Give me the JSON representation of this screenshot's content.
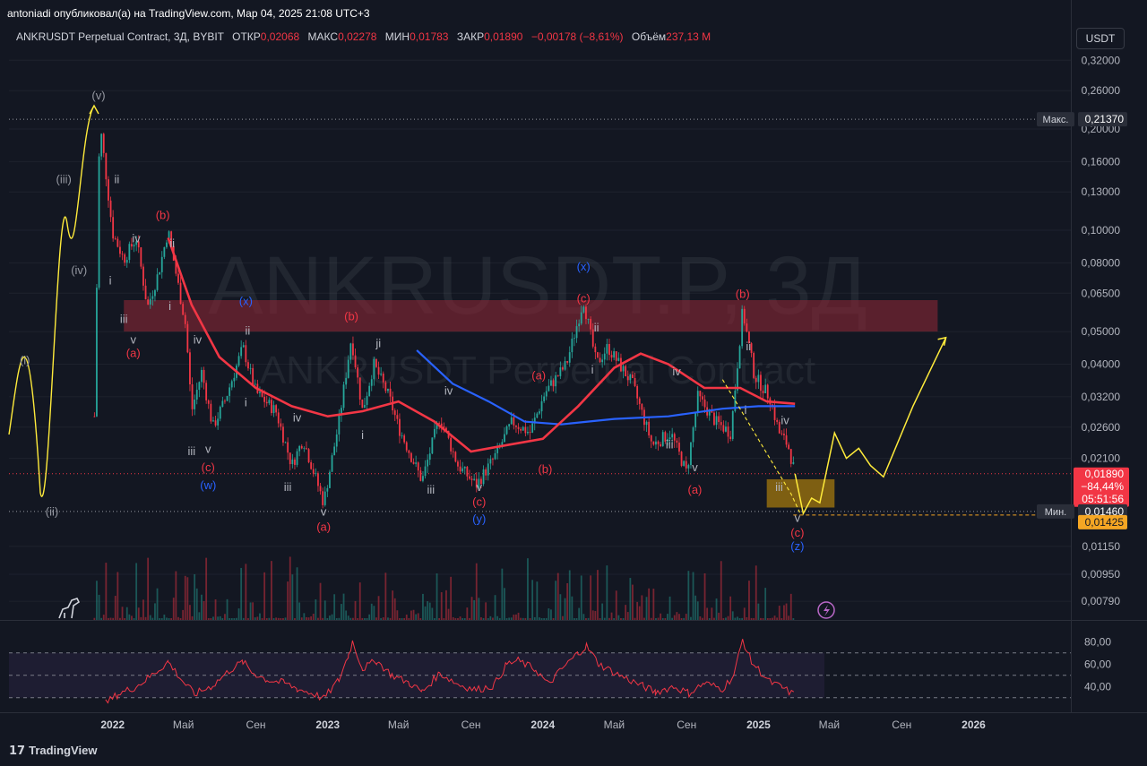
{
  "header": {
    "published": "antoniadi опубликовал(а) на TradingView.com, Мар 04, 2025 21:08 UTC+3",
    "symbol": "ANKRUSDT Perpetual Contract, 3Д, BYBIT",
    "open_label": "ОТКР",
    "open": "0,02068",
    "high_label": "МАКС",
    "high": "0,02278",
    "low_label": "МИН",
    "low": "0,01783",
    "close_label": "ЗАКР",
    "close": "0,01890",
    "change": "−0,00178 (−8,61%)",
    "volume_label": "Объём",
    "volume": "237,13 M",
    "currency": "USDT"
  },
  "watermark": {
    "main": "ANKRUSDT.P, 3Д",
    "sub": "ANKRUSDT Perpetual Contract"
  },
  "footer": {
    "brand": "TradingView"
  },
  "colors": {
    "bg": "#131722",
    "up": "#26a69a",
    "down": "#f23645",
    "ma_red": "#f23645",
    "ma_blue": "#2962ff",
    "wave_yellow": "#ffeb3b",
    "zone_red": "#8b2635",
    "zone_orange": "#b8860b",
    "rsi": "#f23645"
  },
  "chart_data": [
    {
      "type": "candlestick",
      "title": "ANKRUSDT Perpetual Contract, 3Д, BYBIT",
      "y_scale": "log",
      "y_ticks": [
        "0,32000",
        "0,26000",
        "0,20000",
        "0,16000",
        "0,13000",
        "0,10000",
        "0,08000",
        "0,06500",
        "0,05000",
        "0,04000",
        "0,03200",
        "0,02600",
        "0,02100",
        "0,01150",
        "0,00950",
        "0,00790"
      ],
      "x_ticks": [
        "2022",
        "Май",
        "Сен",
        "2023",
        "Май",
        "Сен",
        "2024",
        "Май",
        "Сен",
        "2025",
        "Май",
        "Сен",
        "2026"
      ],
      "x_ticks_bold": [
        "2022",
        "2023",
        "2024",
        "2025",
        "2026"
      ],
      "price_path": [
        [
          "2021-12-01",
          0.028
        ],
        [
          "2021-12-10",
          0.21
        ],
        [
          "2021-12-20",
          0.15
        ],
        [
          "2022-01-01",
          0.098
        ],
        [
          "2022-01-20",
          0.082
        ],
        [
          "2022-02-10",
          0.095
        ],
        [
          "2022-03-01",
          0.059
        ],
        [
          "2022-03-20",
          0.075
        ],
        [
          "2022-04-05",
          0.1
        ],
        [
          "2022-04-20",
          0.072
        ],
        [
          "2022-05-05",
          0.052
        ],
        [
          "2022-05-15",
          0.029
        ],
        [
          "2022-06-01",
          0.038
        ],
        [
          "2022-06-20",
          0.026
        ],
        [
          "2022-07-10",
          0.031
        ],
        [
          "2022-08-10",
          0.045
        ],
        [
          "2022-09-01",
          0.033
        ],
        [
          "2022-10-05",
          0.029
        ],
        [
          "2022-11-01",
          0.02
        ],
        [
          "2022-11-20",
          0.024
        ],
        [
          "2022-12-25",
          0.0155
        ],
        [
          "2023-01-20",
          0.027
        ],
        [
          "2023-02-10",
          0.048
        ],
        [
          "2023-03-01",
          0.029
        ],
        [
          "2023-03-20",
          0.04
        ],
        [
          "2023-04-15",
          0.032
        ],
        [
          "2023-05-01",
          0.026
        ],
        [
          "2023-06-10",
          0.018
        ],
        [
          "2023-07-10",
          0.028
        ],
        [
          "2023-08-10",
          0.02
        ],
        [
          "2023-09-10",
          0.0175
        ],
        [
          "2023-10-10",
          0.021
        ],
        [
          "2023-11-10",
          0.027
        ],
        [
          "2023-12-10",
          0.025
        ],
        [
          "2024-01-05",
          0.033
        ],
        [
          "2024-02-10",
          0.04
        ],
        [
          "2024-03-10",
          0.062
        ],
        [
          "2024-04-01",
          0.04
        ],
        [
          "2024-04-20",
          0.045
        ],
        [
          "2024-06-01",
          0.035
        ],
        [
          "2024-07-05",
          0.023
        ],
        [
          "2024-08-05",
          0.025
        ],
        [
          "2024-09-01",
          0.019
        ],
        [
          "2024-09-20",
          0.032
        ],
        [
          "2024-10-20",
          0.027
        ],
        [
          "2024-11-15",
          0.025
        ],
        [
          "2024-12-05",
          0.058
        ],
        [
          "2024-12-25",
          0.037
        ],
        [
          "2025-01-20",
          0.032
        ],
        [
          "2025-02-05",
          0.025
        ],
        [
          "2025-02-20",
          0.023
        ],
        [
          "2025-03-04",
          0.0189
        ]
      ],
      "ma_red": [
        [
          "2022-04-05",
          0.095
        ],
        [
          "2022-05-15",
          0.06
        ],
        [
          "2022-07-01",
          0.042
        ],
        [
          "2022-09-01",
          0.034
        ],
        [
          "2022-11-01",
          0.03
        ],
        [
          "2023-01-01",
          0.028
        ],
        [
          "2023-03-01",
          0.029
        ],
        [
          "2023-05-01",
          0.031
        ],
        [
          "2023-07-01",
          0.027
        ],
        [
          "2023-09-01",
          0.022
        ],
        [
          "2023-11-01",
          0.023
        ],
        [
          "2024-01-01",
          0.024
        ],
        [
          "2024-03-01",
          0.03
        ],
        [
          "2024-05-01",
          0.039
        ],
        [
          "2024-06-15",
          0.043
        ],
        [
          "2024-08-01",
          0.04
        ],
        [
          "2024-10-01",
          0.034
        ],
        [
          "2024-12-01",
          0.034
        ],
        [
          "2025-01-15",
          0.031
        ],
        [
          "2025-03-04",
          0.0305
        ]
      ],
      "ma_blue": [
        [
          "2023-06-01",
          0.044
        ],
        [
          "2023-08-01",
          0.035
        ],
        [
          "2023-10-01",
          0.031
        ],
        [
          "2023-12-01",
          0.027
        ],
        [
          "2024-02-01",
          0.0265
        ],
        [
          "2024-05-01",
          0.0275
        ],
        [
          "2024-08-01",
          0.028
        ],
        [
          "2024-11-01",
          0.0295
        ],
        [
          "2025-01-01",
          0.03
        ],
        [
          "2025-03-04",
          0.03
        ]
      ],
      "projection": [
        [
          "2025-03-04",
          0.0189
        ],
        [
          "2025-03-18",
          0.0144
        ],
        [
          "2025-04-01",
          0.016
        ],
        [
          "2025-04-15",
          0.0155
        ],
        [
          "2025-05-10",
          0.025
        ],
        [
          "2025-05-30",
          0.021
        ],
        [
          "2025-06-20",
          0.0225
        ],
        [
          "2025-07-10",
          0.02
        ],
        [
          "2025-08-01",
          0.0185
        ],
        [
          "2025-09-20",
          0.03
        ],
        [
          "2025-11-15",
          0.048
        ]
      ],
      "resistance_zone": {
        "from": "2022-01-20",
        "to": "2025-11-01",
        "low": 0.05,
        "high": 0.062
      },
      "support_zone": {
        "from": "2025-01-15",
        "to": "2025-05-10",
        "low": 0.015,
        "high": 0.0182
      },
      "price_labels": [
        {
          "label": "Макс.",
          "value": "0,21370",
          "price": 0.2137,
          "color": "#2a2e39"
        },
        {
          "label": "",
          "value": "0,01890",
          "sub1": "−84,44%",
          "sub2": "05:51:56",
          "price": 0.0189,
          "color": "#f23645"
        },
        {
          "label": "Мин.",
          "value": "0,01460",
          "price": 0.0146,
          "color": "#2a2e39"
        },
        {
          "label": "",
          "value": "0,01425",
          "price": 0.01425,
          "color": "#f5a623"
        }
      ],
      "wave_labels": [
        {
          "t": "(v)",
          "d": "2021-12-08",
          "p": 0.245,
          "c": "#9598a1"
        },
        {
          "t": "(iii)",
          "d": "2021-10-10",
          "p": 0.138,
          "c": "#9598a1"
        },
        {
          "t": "(iv)",
          "d": "2021-11-05",
          "p": 0.074,
          "c": "#9598a1"
        },
        {
          "t": "(i)",
          "d": "2021-08-05",
          "p": 0.04,
          "c": "#9598a1"
        },
        {
          "t": "(ii)",
          "d": "2021-09-20",
          "p": 0.0142,
          "c": "#9598a1"
        },
        {
          "t": "ii",
          "d": "2022-01-08",
          "p": 0.138,
          "c": "#b2b5be"
        },
        {
          "t": "iv",
          "d": "2022-02-10",
          "p": 0.092,
          "c": "#b2b5be"
        },
        {
          "t": "i",
          "d": "2021-12-28",
          "p": 0.069,
          "c": "#b2b5be"
        },
        {
          "t": "iii",
          "d": "2022-01-20",
          "p": 0.053,
          "c": "#b2b5be"
        },
        {
          "t": "v",
          "d": "2022-02-05",
          "p": 0.046,
          "c": "#b2b5be"
        },
        {
          "t": "(a)",
          "d": "2022-02-05",
          "p": 0.042,
          "c": "#f23645"
        },
        {
          "t": "(b)",
          "d": "2022-03-27",
          "p": 0.108,
          "c": "#f23645"
        },
        {
          "t": "ii",
          "d": "2022-04-12",
          "p": 0.089,
          "c": "#b2b5be"
        },
        {
          "t": "i",
          "d": "2022-04-08",
          "p": 0.058,
          "c": "#b2b5be"
        },
        {
          "t": "iv",
          "d": "2022-05-25",
          "p": 0.046,
          "c": "#b2b5be"
        },
        {
          "t": "iii",
          "d": "2022-05-15",
          "p": 0.0215,
          "c": "#b2b5be"
        },
        {
          "t": "v",
          "d": "2022-06-12",
          "p": 0.0218,
          "c": "#b2b5be"
        },
        {
          "t": "(c)",
          "d": "2022-06-12",
          "p": 0.0192,
          "c": "#f23645"
        },
        {
          "t": "(w)",
          "d": "2022-06-12",
          "p": 0.017,
          "c": "#2962ff"
        },
        {
          "t": "(x)",
          "d": "2022-08-15",
          "p": 0.06,
          "c": "#2962ff"
        },
        {
          "t": "ii",
          "d": "2022-08-18",
          "p": 0.049,
          "c": "#b2b5be"
        },
        {
          "t": "i",
          "d": "2022-08-15",
          "p": 0.03,
          "c": "#b2b5be"
        },
        {
          "t": "iv",
          "d": "2022-11-10",
          "p": 0.027,
          "c": "#b2b5be"
        },
        {
          "t": "iii",
          "d": "2022-10-25",
          "p": 0.0168,
          "c": "#b2b5be"
        },
        {
          "t": "v",
          "d": "2022-12-25",
          "p": 0.0142,
          "c": "#b2b5be"
        },
        {
          "t": "(a)",
          "d": "2022-12-25",
          "p": 0.0128,
          "c": "#f23645"
        },
        {
          "t": "(b)",
          "d": "2023-02-10",
          "p": 0.054,
          "c": "#f23645"
        },
        {
          "t": "i",
          "d": "2023-03-01",
          "p": 0.024,
          "c": "#b2b5be"
        },
        {
          "t": "ji",
          "d": "2023-03-28",
          "p": 0.045,
          "c": "#b2b5be"
        },
        {
          "t": "iv",
          "d": "2023-07-25",
          "p": 0.0325,
          "c": "#b2b5be"
        },
        {
          "t": "iii",
          "d": "2023-06-25",
          "p": 0.0165,
          "c": "#b2b5be"
        },
        {
          "t": "v",
          "d": "2023-09-15",
          "p": 0.0168,
          "c": "#b2b5be"
        },
        {
          "t": "(c)",
          "d": "2023-09-15",
          "p": 0.0152,
          "c": "#f23645"
        },
        {
          "t": "(y)",
          "d": "2023-09-15",
          "p": 0.0135,
          "c": "#2962ff"
        },
        {
          "t": "(a)",
          "d": "2023-12-25",
          "p": 0.036,
          "c": "#f23645"
        },
        {
          "t": "(b)",
          "d": "2024-01-05",
          "p": 0.019,
          "c": "#f23645"
        },
        {
          "t": "(x)",
          "d": "2024-03-10",
          "p": 0.076,
          "c": "#2962ff"
        },
        {
          "t": "(c)",
          "d": "2024-03-10",
          "p": 0.061,
          "c": "#f23645"
        },
        {
          "t": "ii",
          "d": "2024-04-01",
          "p": 0.05,
          "c": "#b2b5be"
        },
        {
          "t": "i",
          "d": "2024-03-25",
          "p": 0.0375,
          "c": "#b2b5be"
        },
        {
          "t": "iv",
          "d": "2024-08-15",
          "p": 0.037,
          "c": "#b2b5be"
        },
        {
          "t": "iii",
          "d": "2024-08-03",
          "p": 0.0225,
          "c": "#b2b5be"
        },
        {
          "t": "v",
          "d": "2024-09-15",
          "p": 0.0192,
          "c": "#b2b5be"
        },
        {
          "t": "(a)",
          "d": "2024-09-15",
          "p": 0.0165,
          "c": "#f23645"
        },
        {
          "t": "(b)",
          "d": "2024-12-05",
          "p": 0.063,
          "c": "#f23645"
        },
        {
          "t": "ii",
          "d": "2024-12-15",
          "p": 0.044,
          "c": "#b2b5be"
        },
        {
          "t": "i",
          "d": "2024-12-10",
          "p": 0.0285,
          "c": "#b2b5be"
        },
        {
          "t": "iv",
          "d": "2025-02-15",
          "p": 0.0265,
          "c": "#b2b5be"
        },
        {
          "t": "iii",
          "d": "2025-02-05",
          "p": 0.0168,
          "c": "#b2b5be"
        },
        {
          "t": "v",
          "d": "2025-03-08",
          "p": 0.0136,
          "c": "#b2b5be"
        },
        {
          "t": "(c)",
          "d": "2025-03-08",
          "p": 0.0123,
          "c": "#f23645"
        },
        {
          "t": "(z)",
          "d": "2025-03-08",
          "p": 0.0112,
          "c": "#2962ff"
        }
      ]
    },
    {
      "type": "line",
      "name": "RSI",
      "y_ticks": [
        "80,00",
        "60,00",
        "40,00"
      ],
      "levels": [
        70,
        50,
        30
      ],
      "ylim": [
        25,
        85
      ],
      "points": [
        [
          "2021-12-20",
          25
        ],
        [
          "2022-01-10",
          33
        ],
        [
          "2022-02-10",
          40
        ],
        [
          "2022-03-01",
          47
        ],
        [
          "2022-03-20",
          55
        ],
        [
          "2022-04-05",
          62
        ],
        [
          "2022-05-01",
          44
        ],
        [
          "2022-05-20",
          33
        ],
        [
          "2022-06-20",
          41
        ],
        [
          "2022-07-20",
          55
        ],
        [
          "2022-08-10",
          62
        ],
        [
          "2022-08-25",
          53
        ],
        [
          "2022-09-20",
          46
        ],
        [
          "2022-10-20",
          43
        ],
        [
          "2022-11-10",
          38
        ],
        [
          "2022-12-10",
          33
        ],
        [
          "2022-12-25",
          29
        ],
        [
          "2023-01-20",
          46
        ],
        [
          "2023-02-05",
          68
        ],
        [
          "2023-02-12",
          80
        ],
        [
          "2023-03-01",
          56
        ],
        [
          "2023-03-25",
          63
        ],
        [
          "2023-04-20",
          50
        ],
        [
          "2023-05-20",
          43
        ],
        [
          "2023-06-10",
          35
        ],
        [
          "2023-07-10",
          52
        ],
        [
          "2023-08-10",
          42
        ],
        [
          "2023-09-10",
          37
        ],
        [
          "2023-10-10",
          41
        ],
        [
          "2023-11-01",
          60
        ],
        [
          "2023-11-20",
          63
        ],
        [
          "2023-12-20",
          55
        ],
        [
          "2024-01-10",
          42
        ],
        [
          "2024-02-05",
          57
        ],
        [
          "2024-03-01",
          70
        ],
        [
          "2024-03-15",
          76
        ],
        [
          "2024-04-05",
          60
        ],
        [
          "2024-05-10",
          50
        ],
        [
          "2024-06-20",
          40
        ],
        [
          "2024-07-10",
          35
        ],
        [
          "2024-08-10",
          40
        ],
        [
          "2024-09-05",
          34
        ],
        [
          "2024-10-01",
          43
        ],
        [
          "2024-11-01",
          38
        ],
        [
          "2024-11-20",
          50
        ],
        [
          "2024-12-05",
          82
        ],
        [
          "2024-12-20",
          62
        ],
        [
          "2025-01-20",
          44
        ],
        [
          "2025-02-10",
          39
        ],
        [
          "2025-03-04",
          32
        ]
      ]
    }
  ]
}
